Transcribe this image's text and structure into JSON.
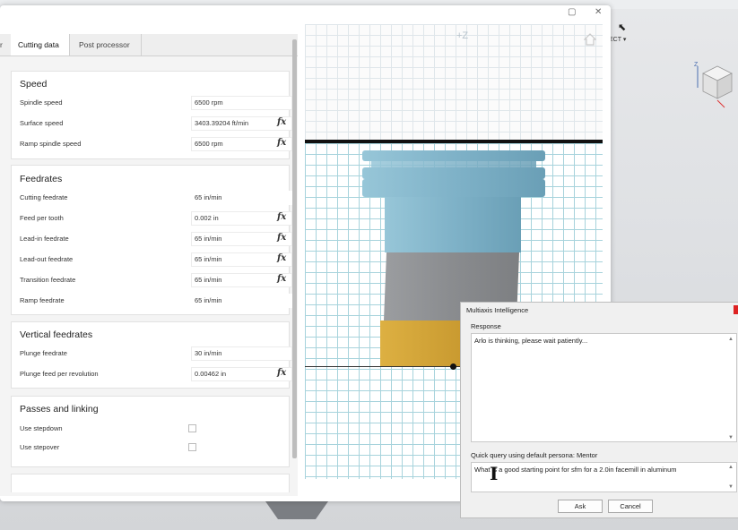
{
  "background": {
    "select_label": "ECT ▾"
  },
  "dialog": {
    "tabs": [
      {
        "label": "r"
      },
      {
        "label": "Cutting data"
      },
      {
        "label": "Post processor"
      }
    ],
    "sections": {
      "speed": {
        "title": "Speed",
        "rows": [
          {
            "label": "Spindle speed",
            "value": "6500 rpm"
          },
          {
            "label": "Surface speed",
            "value": "3403.39204 ft/min"
          },
          {
            "label": "Ramp spindle speed",
            "value": "6500 rpm"
          }
        ]
      },
      "feedrates": {
        "title": "Feedrates",
        "rows": [
          {
            "label": "Cutting feedrate",
            "value": "65 in/min"
          },
          {
            "label": "Feed per tooth",
            "value": "0.002 in"
          },
          {
            "label": "Lead-in feedrate",
            "value": "65 in/min"
          },
          {
            "label": "Lead-out feedrate",
            "value": "65 in/min"
          },
          {
            "label": "Transition feedrate",
            "value": "65 in/min"
          },
          {
            "label": "Ramp feedrate",
            "value": "65 in/min"
          }
        ]
      },
      "vertical": {
        "title": "Vertical feedrates",
        "rows": [
          {
            "label": "Plunge feedrate",
            "value": "30 in/min"
          },
          {
            "label": "Plunge feed per revolution",
            "value": "0.00462 in"
          }
        ]
      },
      "passes": {
        "title": "Passes and linking",
        "rows": [
          {
            "label": "Use stepdown"
          },
          {
            "label": "Use stepover"
          }
        ]
      }
    },
    "fx": "fx",
    "preview": {
      "axis_label": "+Z"
    }
  },
  "ai_panel": {
    "title": "Multiaxis Intelligence",
    "response_label": "Response",
    "response_text": "Arlo is thinking, please wait patiently...",
    "query_label": "Quick query using default persona: Mentor",
    "query_text": "What is a good starting point for sfm for a 2.0in facemill in aluminum",
    "ask_button": "Ask",
    "cancel_button": "Cancel"
  },
  "colors": {
    "tool_upper": "#8bbcd0",
    "tool_mid": "#8f9194",
    "tool_insert": "#d4a537",
    "close_red": "#dd2222"
  },
  "icons": [
    "restore-icon",
    "close-icon",
    "home-icon",
    "view-cube-icon",
    "fx-icon",
    "checkbox-icon",
    "text-cursor-icon",
    "pointer-icon"
  ]
}
